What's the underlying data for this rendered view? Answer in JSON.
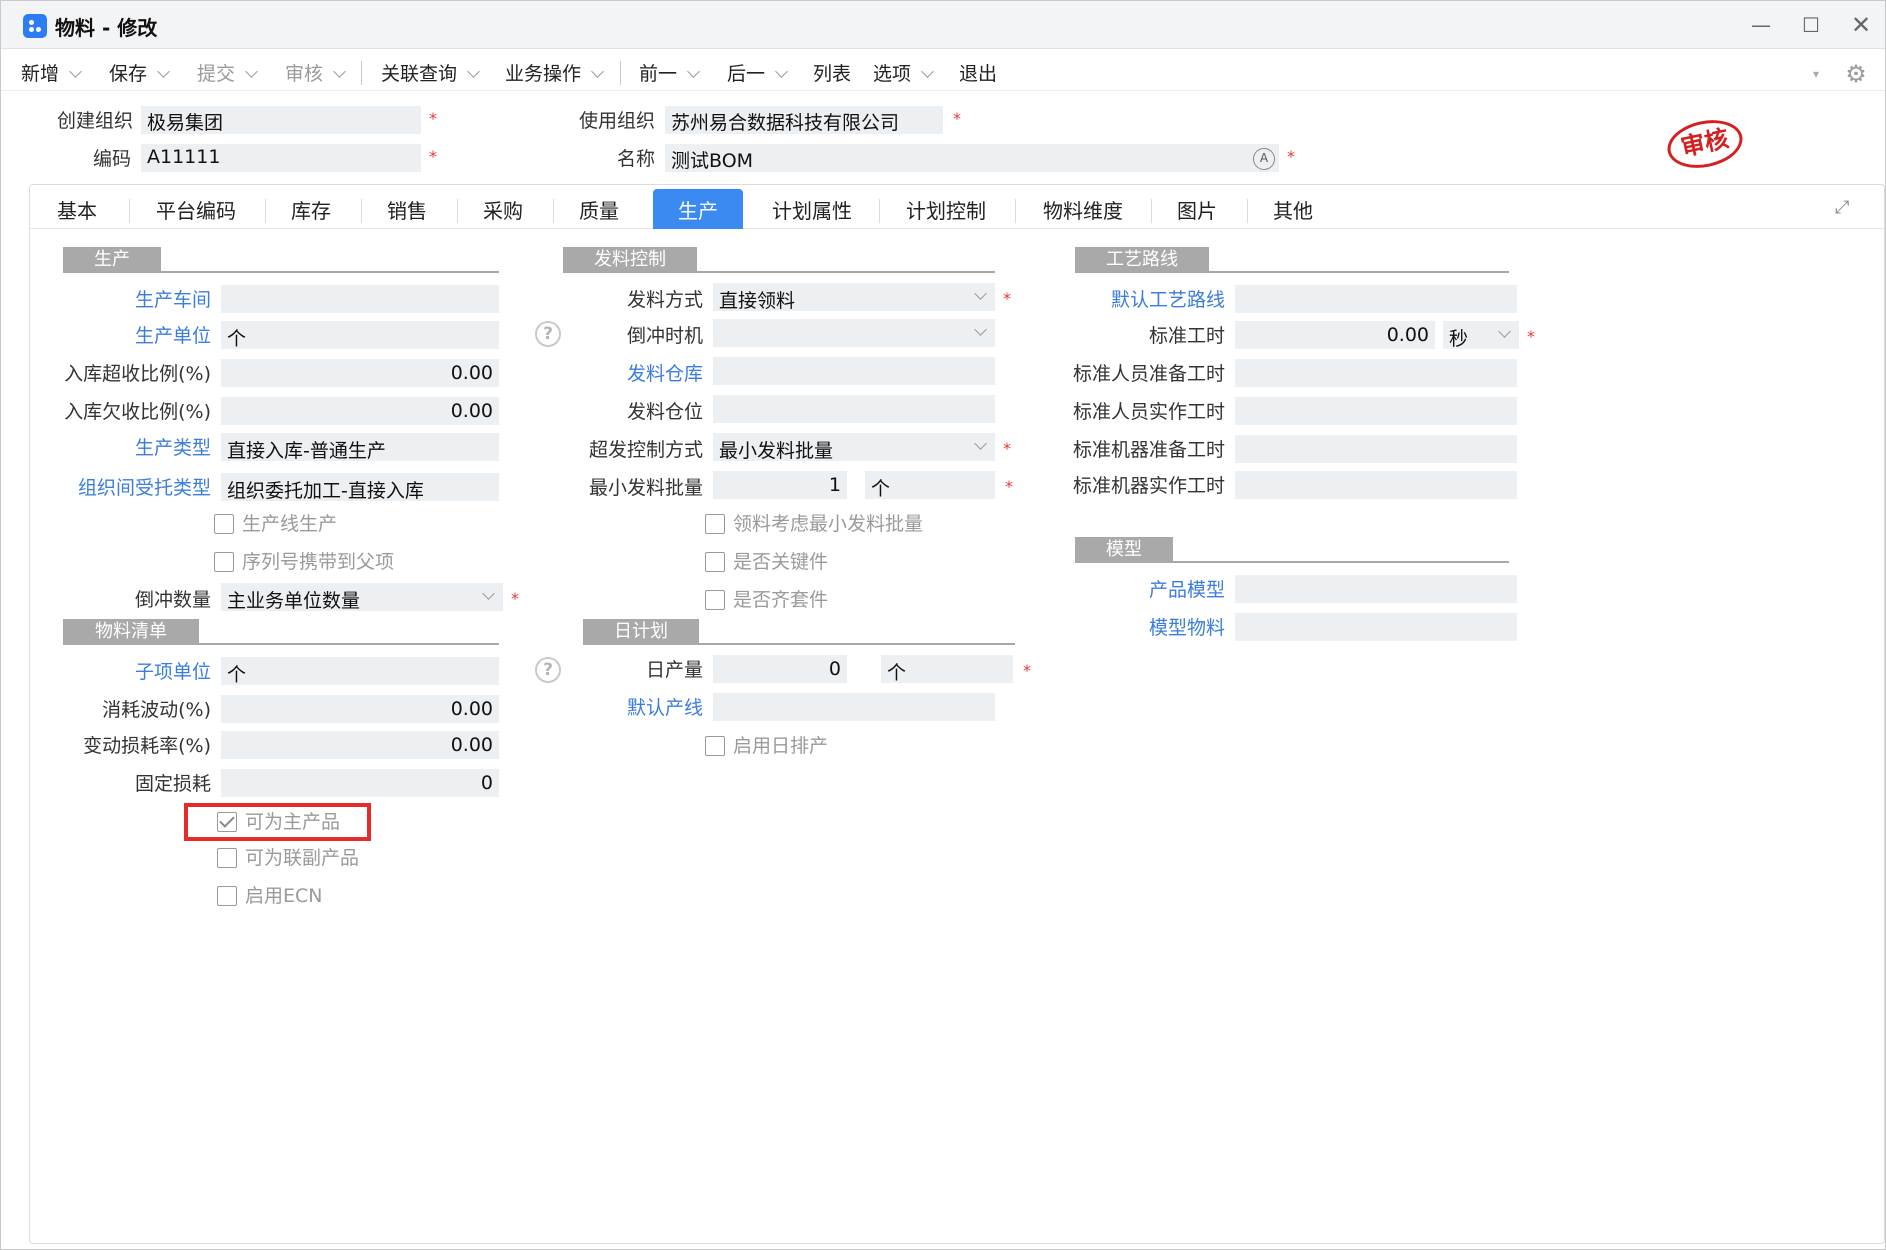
{
  "window": {
    "title": "物料 - 修改",
    "min": "—",
    "max": "☐",
    "close": "✕"
  },
  "toolbar": {
    "items": [
      {
        "label": "新增",
        "dropdown": true,
        "disabled": false
      },
      {
        "label": "保存",
        "dropdown": true,
        "disabled": false
      },
      {
        "label": "提交",
        "dropdown": true,
        "disabled": true
      },
      {
        "label": "审核",
        "dropdown": true,
        "disabled": true
      },
      {
        "label": "关联查询",
        "dropdown": true,
        "disabled": false
      },
      {
        "label": "业务操作",
        "dropdown": true,
        "disabled": false
      },
      {
        "label": "前一",
        "dropdown": true,
        "disabled": false
      },
      {
        "label": "后一",
        "dropdown": true,
        "disabled": false
      },
      {
        "label": "列表",
        "dropdown": false,
        "disabled": false
      },
      {
        "label": "选项",
        "dropdown": true,
        "disabled": false
      },
      {
        "label": "退出",
        "dropdown": false,
        "disabled": false
      }
    ],
    "settings_icon": "gear-icon"
  },
  "header": {
    "create_org_label": "创建组织",
    "create_org_value": "极易集团",
    "use_org_label": "使用组织",
    "use_org_value": "苏州易合数据科技有限公司",
    "code_label": "编码",
    "code_value": "A11111",
    "name_label": "名称",
    "name_value": "测试BOM",
    "stamp": "审核",
    "required_mark": "*"
  },
  "tabs": [
    "基本",
    "平台编码",
    "库存",
    "销售",
    "采购",
    "质量",
    "生产",
    "计划属性",
    "计划控制",
    "物料维度",
    "图片",
    "其他"
  ],
  "active_tab": "生产",
  "production": {
    "title": "生产",
    "workshop_label": "生产车间",
    "workshop_value": "",
    "unit_label": "生产单位",
    "unit_value": "个",
    "over_ratio_label": "入库超收比例(%)",
    "over_ratio_value": "0.00",
    "under_ratio_label": "入库欠收比例(%)",
    "under_ratio_value": "0.00",
    "type_label": "生产类型",
    "type_value": "直接入库-普通生产",
    "inter_org_label": "组织间受托类型",
    "inter_org_value": "组织委托加工-直接入库",
    "line_production": "生产线生产",
    "serial_carry": "序列号携带到父项",
    "backflush_qty_label": "倒冲数量",
    "backflush_qty_value": "主业务单位数量"
  },
  "bom": {
    "title": "物料清单",
    "sub_unit_label": "子项单位",
    "sub_unit_value": "个",
    "consume_label": "消耗波动(%)",
    "consume_value": "0.00",
    "loss_rate_label": "变动损耗率(%)",
    "loss_rate_value": "0.00",
    "fixed_loss_label": "固定损耗",
    "fixed_loss_value": "0",
    "main_product": "可为主产品",
    "co_product": "可为联副产品",
    "ecn": "启用ECN"
  },
  "issue": {
    "title": "发料控制",
    "method_label": "发料方式",
    "method_value": "直接领料",
    "backflush_time_label": "倒冲时机",
    "backflush_time_value": "",
    "warehouse_label": "发料仓库",
    "warehouse_value": "",
    "location_label": "发料仓位",
    "location_value": "",
    "over_method_label": "超发控制方式",
    "over_method_value": "最小发料批量",
    "min_batch_label": "最小发料批量",
    "min_batch_value": "1",
    "min_batch_unit": "个",
    "consider_min_batch": "领料考虑最小发料批量",
    "key_part": "是否关键件",
    "kit_part": "是否齐套件"
  },
  "daily_plan": {
    "title": "日计划",
    "daily_output_label": "日产量",
    "daily_output_value": "0",
    "daily_output_unit": "个",
    "default_line_label": "默认产线",
    "default_line_value": "",
    "enable_daily": "启用日排产"
  },
  "routing": {
    "title": "工艺路线",
    "default_routing_label": "默认工艺路线",
    "default_routing_value": "",
    "std_time_label": "标准工时",
    "std_time_value": "0.00",
    "std_time_unit": "秒",
    "std_labor_prep_label": "标准人员准备工时",
    "std_labor_prep_value": "",
    "std_labor_actual_label": "标准人员实作工时",
    "std_labor_actual_value": "",
    "std_machine_prep_label": "标准机器准备工时",
    "std_machine_prep_value": "",
    "std_machine_actual_label": "标准机器实作工时",
    "std_machine_actual_value": ""
  },
  "model": {
    "title": "模型",
    "product_model_label": "产品模型",
    "product_model_value": "",
    "model_material_label": "模型物料",
    "model_material_value": ""
  },
  "help_glyph": "?"
}
